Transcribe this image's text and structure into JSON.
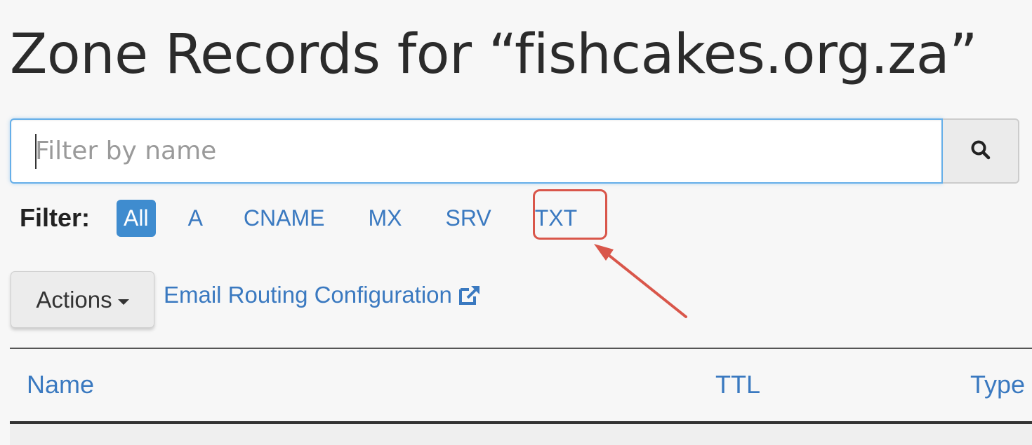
{
  "page": {
    "title": "Zone Records for “fishcakes.org.za”"
  },
  "search": {
    "placeholder": "Filter by name",
    "value": "",
    "button_icon": "search-icon"
  },
  "filter": {
    "label": "Filter:",
    "options": [
      {
        "label": "All",
        "active": true
      },
      {
        "label": "A",
        "active": false
      },
      {
        "label": "CNAME",
        "active": false
      },
      {
        "label": "MX",
        "active": false
      },
      {
        "label": "SRV",
        "active": false
      },
      {
        "label": "TXT",
        "active": false
      }
    ],
    "highlighted": "TXT"
  },
  "toolbar": {
    "actions_label": "Actions",
    "email_routing_label": "Email Routing Configuration",
    "email_routing_icon": "external-link-icon"
  },
  "table": {
    "columns": [
      "Name",
      "TTL",
      "Type"
    ]
  },
  "colors": {
    "accent": "#3f8ccf",
    "link": "#3a79c0",
    "annotation": "#d9564a",
    "focus_border": "#66afe9"
  }
}
